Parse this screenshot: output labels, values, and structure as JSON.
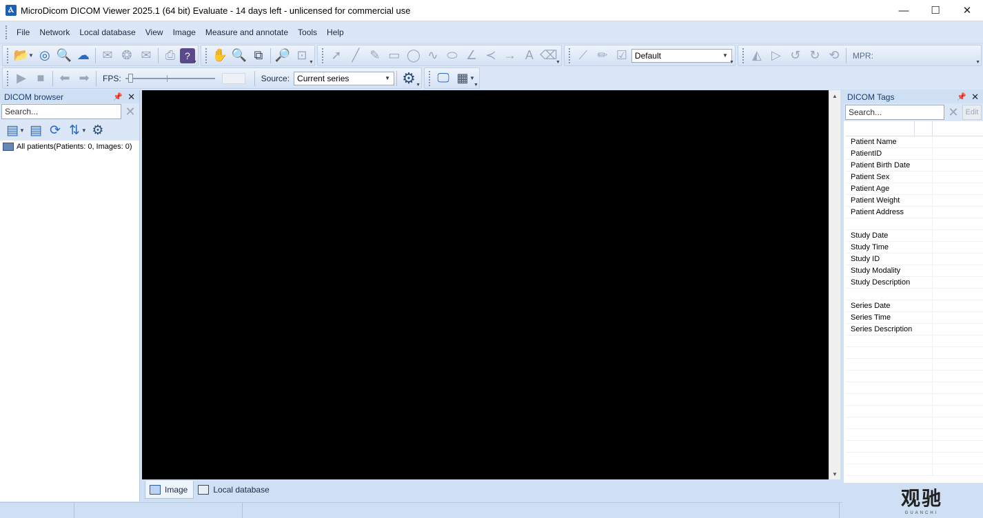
{
  "window": {
    "title": "MicroDicom DICOM Viewer 2025.1 (64 bit) Evaluate - 14 days left - unlicensed for commercial use",
    "minimize": "—",
    "maximize": "☐",
    "close": "✕"
  },
  "menu": [
    "File",
    "Network",
    "Local database",
    "View",
    "Image",
    "Measure and annotate",
    "Tools",
    "Help"
  ],
  "toolbar": {
    "preset_value": "Default",
    "mpr_label": "MPR:",
    "fps_label": "FPS:",
    "source_label": "Source:",
    "source_value": "Current series",
    "fps_slider_position": 0
  },
  "dicom_browser": {
    "title": "DICOM browser",
    "search_placeholder": "Search...",
    "tree_root": "All patients(Patients: 0, Images: 0)"
  },
  "dicom_tags": {
    "title": "DICOM Tags",
    "search_placeholder": "Search...",
    "edit_label": "Edit",
    "rows": [
      "Patient Name",
      "PatientID",
      "Patient Birth Date",
      "Patient Sex",
      "Patient Age",
      "Patient Weight",
      "Patient Address",
      "",
      "Study Date",
      "Study Time",
      "Study ID",
      "Study Modality",
      "Study Description",
      "",
      "Series Date",
      "Series Time",
      "Series Description",
      "",
      "",
      "",
      "",
      "",
      "",
      "",
      "",
      "",
      "",
      "",
      ""
    ]
  },
  "viewer_tabs": {
    "image": "Image",
    "local_database": "Local database"
  },
  "watermark": {
    "main": "观驰",
    "sub": "GUANCHI"
  }
}
